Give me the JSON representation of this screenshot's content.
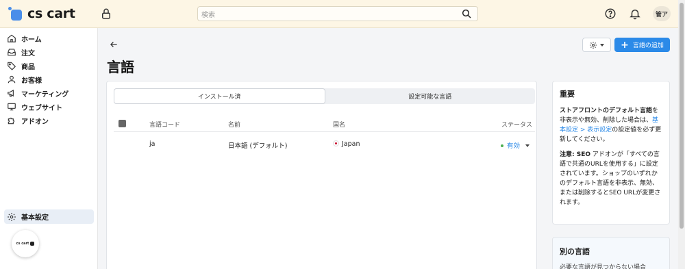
{
  "header": {
    "logo_text": "cs cart",
    "search_placeholder": "検索",
    "avatar_initials": "管ア"
  },
  "sidebar": {
    "items": [
      {
        "label": "ホーム",
        "icon": "home-icon"
      },
      {
        "label": "注文",
        "icon": "inbox-icon"
      },
      {
        "label": "商品",
        "icon": "tag-icon"
      },
      {
        "label": "お客様",
        "icon": "user-icon"
      },
      {
        "label": "マーケティング",
        "icon": "megaphone-icon"
      },
      {
        "label": "ウェブサイト",
        "icon": "monitor-icon"
      },
      {
        "label": "アドオン",
        "icon": "puzzle-icon"
      }
    ],
    "settings_label": "基本設定",
    "bottom_logo_text": "cs cart"
  },
  "page": {
    "title": "言語",
    "add_button_label": "言語の追加"
  },
  "tabs": [
    {
      "label": "インストール済",
      "active": true
    },
    {
      "label": "設定可能な言語",
      "active": false
    }
  ],
  "table": {
    "headers": {
      "code": "言語コード",
      "name": "名前",
      "country": "国名",
      "status": "ステータス"
    },
    "rows": [
      {
        "code": "ja",
        "name": "日本語 (デフォルト)",
        "country": "Japan",
        "status": "有効"
      }
    ]
  },
  "info": {
    "title": "重要",
    "p1_bold": "ストアフロントのデフォルト言語",
    "p1_text1": "を非表示や無効、削除した場合は、",
    "p1_link": "基本設定 > 表示設定",
    "p1_text2": "の設定値を必ず更新してください。",
    "p2_bold": "注意: SEO",
    "p2_text": " アドオンが「すべての言語で共通のURLを使用する」に設定されています。ショップのいずれかのデフォルト言語を非表示、無効、または削除するとSEO URLが変更されます。"
  },
  "other": {
    "title": "別の言語",
    "desc": "必要な言語が見つからない場合"
  },
  "colors": {
    "accent": "#2b8ae8",
    "header_bg": "#fdf6e5",
    "status_dot": "#4caf50"
  }
}
